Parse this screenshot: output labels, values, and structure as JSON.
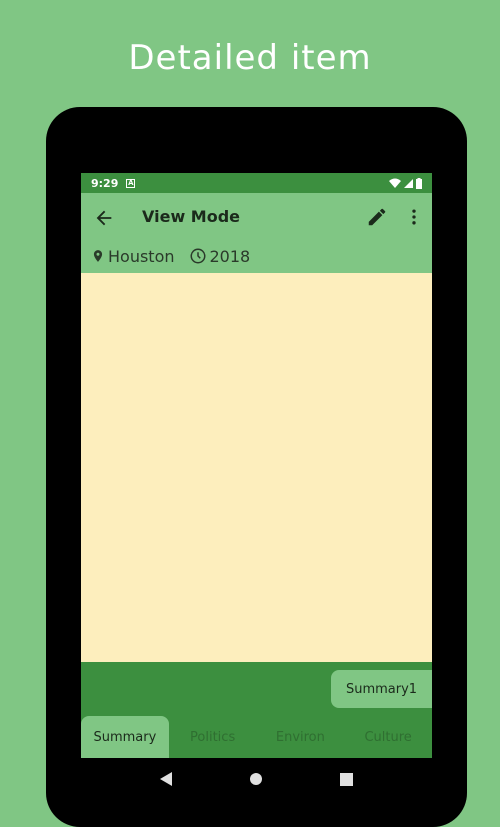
{
  "page": {
    "header": "Detailed item"
  },
  "status_bar": {
    "time": "9:29",
    "notification": "A"
  },
  "app_bar": {
    "title": "View Mode",
    "location": "Houston",
    "year": "2018"
  },
  "content": {
    "summary_chip": "Summary1"
  },
  "tabs": [
    {
      "label": "Summary",
      "active": true
    },
    {
      "label": "Politics",
      "active": false
    },
    {
      "label": "Environ",
      "active": false
    },
    {
      "label": "Culture",
      "active": false
    }
  ],
  "colors": {
    "background": "#80c684",
    "primary_dark": "#3c8f3f",
    "content_bg": "#fdeebd"
  },
  "icons": [
    "arrow-back-icon",
    "edit-pencil-icon",
    "more-vert-icon",
    "location-pin-icon",
    "clock-icon",
    "wifi-icon",
    "signal-icon",
    "battery-icon",
    "nav-back-icon",
    "nav-home-icon",
    "nav-recents-icon"
  ]
}
